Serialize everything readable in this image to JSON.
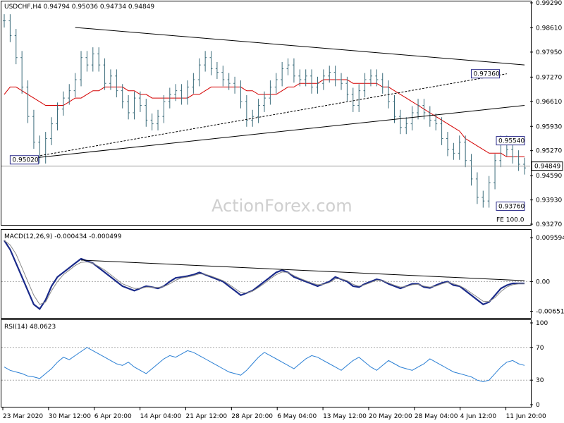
{
  "chart_data": [
    {
      "id": "price",
      "type": "ohlc",
      "title": "USDCHF,H4  0.94794 0.95036 0.94734 0.94849",
      "symbol": "USDCHF",
      "timeframe": "H4",
      "last_close": "0.94849",
      "ylim": [
        0.9327,
        0.9929
      ],
      "yticks": [
        "0.99290",
        "0.98610",
        "0.97950",
        "0.97270",
        "0.96610",
        "0.95930",
        "0.95270",
        "0.94590",
        "0.93930",
        "0.93270"
      ],
      "xticks": [
        "23 Mar 2020",
        "30 Mar 12:00",
        "6 Apr 20:00",
        "14 Apr 04:00",
        "21 Apr 12:00",
        "28 Apr 20:00",
        "6 May 04:00",
        "13 May 12:00",
        "20 May 20:00",
        "28 May 04:00",
        "4 Jun 12:00",
        "11 Jun 20:00"
      ],
      "close_series": [
        0.988,
        0.984,
        0.978,
        0.97,
        0.962,
        0.955,
        0.951,
        0.956,
        0.96,
        0.964,
        0.967,
        0.969,
        0.972,
        0.978,
        0.976,
        0.979,
        0.976,
        0.971,
        0.973,
        0.969,
        0.966,
        0.963,
        0.967,
        0.965,
        0.961,
        0.96,
        0.962,
        0.966,
        0.968,
        0.969,
        0.967,
        0.97,
        0.972,
        0.976,
        0.978,
        0.975,
        0.974,
        0.972,
        0.971,
        0.97,
        0.966,
        0.961,
        0.962,
        0.965,
        0.967,
        0.97,
        0.972,
        0.975,
        0.976,
        0.973,
        0.972,
        0.973,
        0.97,
        0.971,
        0.973,
        0.974,
        0.972,
        0.971,
        0.968,
        0.965,
        0.969,
        0.972,
        0.973,
        0.972,
        0.97,
        0.966,
        0.962,
        0.959,
        0.96,
        0.963,
        0.965,
        0.963,
        0.961,
        0.96,
        0.956,
        0.953,
        0.952,
        0.955,
        0.95,
        0.945,
        0.94,
        0.939,
        0.944,
        0.95,
        0.955,
        0.953,
        0.951,
        0.949,
        0.948
      ],
      "ma_series": [
        0.968,
        0.97,
        0.97,
        0.969,
        0.968,
        0.967,
        0.966,
        0.965,
        0.965,
        0.965,
        0.965,
        0.966,
        0.967,
        0.967,
        0.968,
        0.969,
        0.969,
        0.97,
        0.97,
        0.97,
        0.97,
        0.969,
        0.969,
        0.968,
        0.968,
        0.967,
        0.967,
        0.967,
        0.967,
        0.967,
        0.967,
        0.967,
        0.968,
        0.968,
        0.969,
        0.97,
        0.97,
        0.97,
        0.97,
        0.97,
        0.97,
        0.969,
        0.969,
        0.968,
        0.968,
        0.968,
        0.968,
        0.969,
        0.97,
        0.97,
        0.971,
        0.971,
        0.971,
        0.971,
        0.972,
        0.972,
        0.972,
        0.972,
        0.972,
        0.971,
        0.971,
        0.971,
        0.971,
        0.971,
        0.97,
        0.97,
        0.969,
        0.968,
        0.967,
        0.966,
        0.965,
        0.964,
        0.963,
        0.962,
        0.961,
        0.96,
        0.959,
        0.958,
        0.956,
        0.955,
        0.954,
        0.953,
        0.952,
        0.952,
        0.952,
        0.951,
        0.951,
        0.951,
        0.951
      ],
      "trendlines": [
        {
          "from": [
            2,
            0.9502
          ],
          "to": [
            88,
            0.965
          ]
        },
        {
          "from": [
            12,
            0.9862
          ],
          "to": [
            90,
            0.976
          ]
        },
        {
          "from": [
            2,
            0.9502
          ],
          "to": [
            85,
            0.9736
          ]
        }
      ],
      "horizontal_line": 0.94849,
      "annotations": [
        {
          "text": "0.95020",
          "x": 1,
          "y": 0.9502
        },
        {
          "text": "0.97360",
          "x": 79,
          "y": 0.9736
        },
        {
          "text": "0.95540",
          "x": 105,
          "y": 0.9554
        },
        {
          "text": "0.93760",
          "x": 104,
          "y": 0.9376
        },
        {
          "text": "FE 100.0",
          "x": 108,
          "y": 0.933
        }
      ],
      "watermark": "ActionForex.com"
    },
    {
      "id": "macd",
      "type": "line",
      "title": "MACD(12,26,9) -0.000434 -0.000499",
      "ylim": [
        -0.0075,
        0.0107
      ],
      "yticks": [
        "0.009594",
        "0.00",
        "-0.006517"
      ],
      "series": [
        {
          "values": [
            0.009,
            0.007,
            0.004,
            0.001,
            -0.002,
            -0.005,
            -0.006,
            -0.004,
            -0.001,
            0.001,
            0.002,
            0.003,
            0.004,
            0.005,
            0.0045,
            0.004,
            0.003,
            0.002,
            0.001,
            0.0,
            -0.001,
            -0.0015,
            -0.002,
            -0.0015,
            -0.001,
            -0.0012,
            -0.0015,
            -0.001,
            0.0,
            0.0008,
            0.001,
            0.0012,
            0.0015,
            0.002,
            0.0015,
            0.001,
            0.0005,
            0.0,
            -0.001,
            -0.002,
            -0.003,
            -0.0025,
            -0.002,
            -0.001,
            0.0,
            0.001,
            0.002,
            0.0025,
            0.002,
            0.001,
            0.0005,
            0.0,
            -0.0005,
            -0.001,
            -0.0005,
            0.0,
            0.001,
            0.0005,
            0.0,
            -0.001,
            -0.0012,
            -0.0005,
            0.0,
            0.0005,
            0.0002,
            -0.0005,
            -0.001,
            -0.0015,
            -0.001,
            -0.0005,
            -0.0005,
            -0.0012,
            -0.0014,
            -0.0008,
            -0.0003,
            0.0,
            -0.0008,
            -0.001,
            -0.002,
            -0.003,
            -0.004,
            -0.005,
            -0.0045,
            -0.003,
            -0.0015,
            -0.0008,
            -0.0004,
            -0.0004,
            -0.0004
          ]
        },
        {
          "values": [
            0.009,
            0.008,
            0.006,
            0.003,
            0.0,
            -0.003,
            -0.005,
            -0.0045,
            -0.002,
            0.0,
            0.0015,
            0.0025,
            0.0035,
            0.0042,
            0.0043,
            0.004,
            0.0033,
            0.0025,
            0.0015,
            0.0005,
            -0.0005,
            -0.001,
            -0.0015,
            -0.0015,
            -0.0012,
            -0.0012,
            -0.0013,
            -0.0011,
            -0.0005,
            0.0003,
            0.0008,
            0.001,
            0.0013,
            0.0017,
            0.0016,
            0.0012,
            0.0007,
            0.0002,
            -0.0006,
            -0.0015,
            -0.0024,
            -0.0025,
            -0.0021,
            -0.0013,
            -0.0004,
            0.0006,
            0.0015,
            0.0021,
            0.002,
            0.0013,
            0.0007,
            0.0002,
            -0.0003,
            -0.0007,
            -0.0006,
            -0.0002,
            0.0006,
            0.0006,
            0.0002,
            -0.0006,
            -0.001,
            -0.0007,
            -0.0002,
            0.0003,
            0.0002,
            -0.0003,
            -0.0008,
            -0.0012,
            -0.0011,
            -0.0007,
            -0.0006,
            -0.001,
            -0.0012,
            -0.001,
            -0.0005,
            -0.0001,
            -0.0005,
            -0.0009,
            -0.0016,
            -0.0025,
            -0.0034,
            -0.0043,
            -0.0044,
            -0.0035,
            -0.0022,
            -0.0012,
            -0.0007,
            -0.0005,
            -0.0005
          ]
        }
      ],
      "trendline": {
        "from": [
          13,
          0.0047
        ],
        "to": [
          88,
          0.0002
        ]
      }
    },
    {
      "id": "rsi",
      "type": "line",
      "title": "RSI(14) 48.0623",
      "ylim": [
        0,
        100
      ],
      "yticks": [
        "100",
        "70",
        "30",
        "0"
      ],
      "levels": [
        70,
        30
      ],
      "series": [
        {
          "values": [
            46,
            42,
            40,
            38,
            35,
            34,
            32,
            38,
            44,
            52,
            58,
            55,
            60,
            65,
            70,
            66,
            62,
            58,
            54,
            50,
            48,
            52,
            46,
            42,
            38,
            44,
            50,
            56,
            60,
            58,
            62,
            66,
            64,
            60,
            56,
            52,
            48,
            44,
            40,
            38,
            36,
            42,
            50,
            58,
            64,
            60,
            56,
            52,
            48,
            44,
            50,
            56,
            60,
            58,
            54,
            50,
            46,
            42,
            48,
            54,
            58,
            52,
            46,
            42,
            48,
            54,
            50,
            46,
            44,
            42,
            46,
            50,
            56,
            52,
            48,
            44,
            40,
            38,
            36,
            34,
            30,
            28,
            30,
            38,
            46,
            52,
            54,
            50,
            48
          ]
        }
      ]
    }
  ]
}
